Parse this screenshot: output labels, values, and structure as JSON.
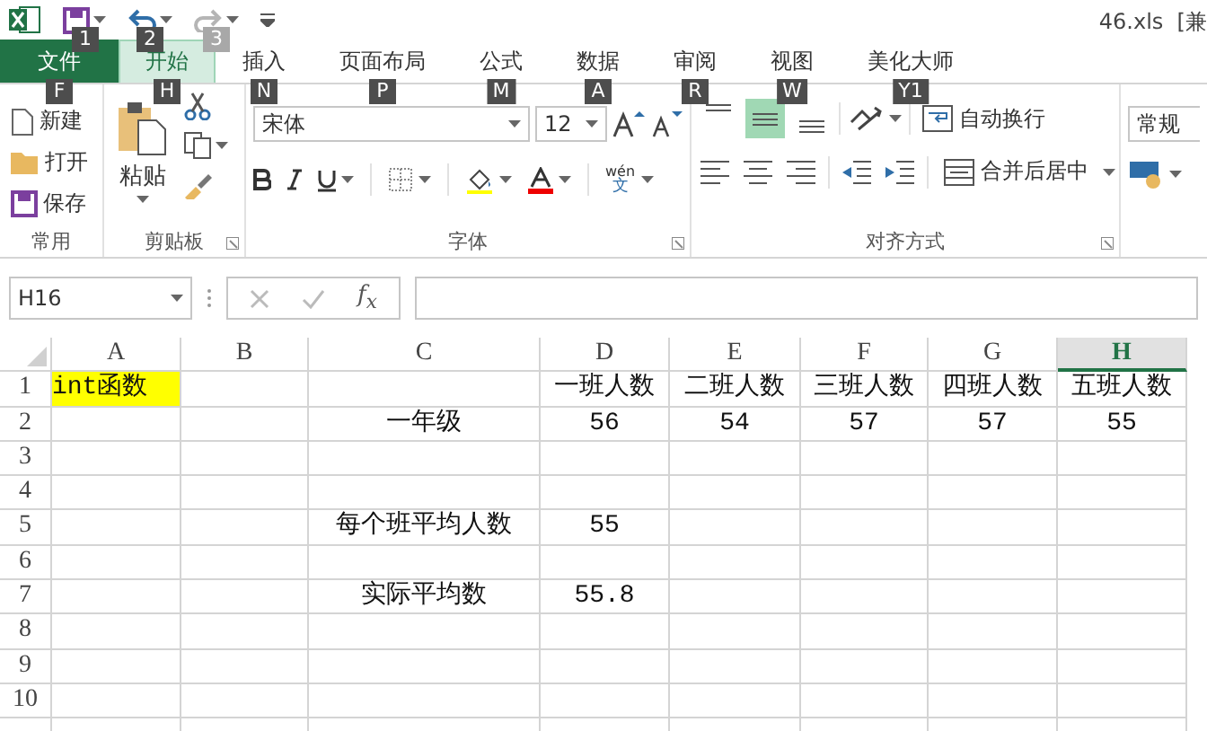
{
  "title_bar": {
    "quick_access": [
      {
        "kind": "save",
        "key_tip": "1",
        "disabled": false
      },
      {
        "kind": "undo",
        "key_tip": "2",
        "disabled": false
      },
      {
        "kind": "redo",
        "key_tip": "3",
        "disabled": true
      }
    ],
    "title": "46.xls  [兼"
  },
  "tabs": [
    {
      "label": "文件",
      "key_tip": "F",
      "kind": "file",
      "selected": false
    },
    {
      "label": "开始",
      "key_tip": "H",
      "kind": "tab",
      "selected": true
    },
    {
      "label": "插入",
      "key_tip": "N",
      "kind": "tab",
      "selected": false
    },
    {
      "label": "页面布局",
      "key_tip": "P",
      "kind": "tab",
      "selected": false
    },
    {
      "label": "公式",
      "key_tip": "M",
      "kind": "tab",
      "selected": false
    },
    {
      "label": "数据",
      "key_tip": "A",
      "kind": "tab",
      "selected": false
    },
    {
      "label": "审阅",
      "key_tip": "R",
      "kind": "tab",
      "selected": false
    },
    {
      "label": "视图",
      "key_tip": "W",
      "kind": "tab",
      "selected": false
    },
    {
      "label": "美化大师",
      "key_tip": "Y1",
      "kind": "tab",
      "selected": false
    }
  ],
  "ribbon": {
    "common": {
      "label": "常用",
      "items": [
        {
          "kind": "new",
          "label": "新建"
        },
        {
          "kind": "open",
          "label": "打开"
        },
        {
          "kind": "save",
          "label": "保存"
        }
      ]
    },
    "clipboard": {
      "label": "剪贴板",
      "paste": "粘贴"
    },
    "font": {
      "label": "字体",
      "name": "宋体",
      "size": "12",
      "phonetic_top": "wén",
      "phonetic_bottom": "文"
    },
    "alignment": {
      "label": "对齐方式",
      "vertical": [
        {
          "kind": "top",
          "selected": false
        },
        {
          "kind": "middle",
          "selected": true
        },
        {
          "kind": "bottom",
          "selected": false
        }
      ],
      "wrap": "自动换行",
      "merge": "合并后居中"
    },
    "number": {
      "format": "常规"
    }
  },
  "formula_bar": {
    "name_box": "H16",
    "fx": "f$_{x}$"
  },
  "sheet": {
    "columns": [
      {
        "label": "A",
        "selected": false
      },
      {
        "label": "B",
        "selected": false
      },
      {
        "label": "C",
        "selected": false
      },
      {
        "label": "D",
        "selected": false
      },
      {
        "label": "E",
        "selected": false
      },
      {
        "label": "F",
        "selected": false
      },
      {
        "label": "G",
        "selected": false
      },
      {
        "label": "H",
        "selected": true
      }
    ],
    "rows": [
      {
        "number": "1",
        "cells": [
          {
            "text": "int函数",
            "color": "#ffff00"
          },
          "",
          "",
          "一班人数",
          "二班人数",
          "三班人数",
          "四班人数",
          "五班人数"
        ]
      },
      {
        "number": "2",
        "cells": [
          "",
          "",
          "一年级",
          "56",
          "54",
          "57",
          "57",
          "55"
        ]
      },
      {
        "number": "3",
        "cells": [
          "",
          "",
          "",
          "",
          "",
          "",
          "",
          ""
        ]
      },
      {
        "number": "4",
        "cells": [
          "",
          "",
          "",
          "",
          "",
          "",
          "",
          ""
        ]
      },
      {
        "number": "5",
        "cells": [
          "",
          "",
          "每个班平均人数",
          "55",
          "",
          "",
          "",
          ""
        ]
      },
      {
        "number": "6",
        "cells": [
          "",
          "",
          "",
          "",
          "",
          "",
          "",
          ""
        ]
      },
      {
        "number": "7",
        "cells": [
          "",
          "",
          "实际平均数",
          "55.8",
          "",
          "",
          "",
          ""
        ]
      },
      {
        "number": "8",
        "cells": [
          "",
          "",
          "",
          "",
          "",
          "",
          "",
          ""
        ]
      },
      {
        "number": "9",
        "cells": [
          "",
          "",
          "",
          "",
          "",
          "",
          "",
          ""
        ]
      },
      {
        "number": "10",
        "cells": [
          "",
          "",
          "",
          "",
          "",
          "",
          "",
          ""
        ]
      }
    ]
  }
}
